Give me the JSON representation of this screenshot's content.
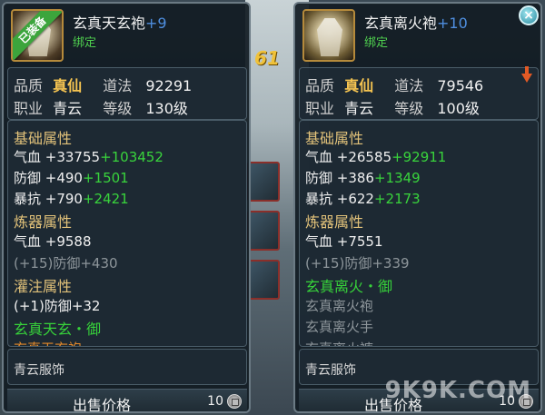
{
  "background": {
    "number": "61"
  },
  "left": {
    "ribbon": "已装备",
    "name": "玄真天玄袍",
    "plus": "+9",
    "bound": "绑定",
    "quality_label": "品质",
    "quality_value": "真仙",
    "daofa_label": "道法",
    "daofa_value": "92291",
    "class_label": "职业",
    "class_value": "青云",
    "level_label": "等级",
    "level_value": "130级",
    "lines": [
      {
        "text": "基础属性",
        "bonus": "",
        "style": "head"
      },
      {
        "text": "气血 +33755",
        "bonus": "+103452",
        "style": "normal"
      },
      {
        "text": "防御 +490",
        "bonus": "+1501",
        "style": "normal"
      },
      {
        "text": "暴抗 +790",
        "bonus": "+2421",
        "style": "normal"
      },
      {
        "text": "炼器属性",
        "bonus": "",
        "style": "head"
      },
      {
        "text": "气血 +9588",
        "bonus": "",
        "style": "normal"
      },
      {
        "text": "(+15)防御+430",
        "bonus": "",
        "style": "grey"
      },
      {
        "text": "灌注属性",
        "bonus": "",
        "style": "head"
      },
      {
        "text": "(+1)防御+32",
        "bonus": "",
        "style": "normal"
      },
      {
        "text": "玄真天玄・御",
        "bonus": "",
        "style": "green"
      },
      {
        "text": "玄真天玄袍",
        "bonus": "",
        "style": "orange"
      }
    ],
    "tag": "青云服饰",
    "price_label": "出售价格",
    "price_value": "10"
  },
  "right": {
    "name": "玄真离火袍",
    "plus": "+10",
    "bound": "绑定",
    "quality_label": "品质",
    "quality_value": "真仙",
    "daofa_label": "道法",
    "daofa_value": "79546",
    "class_label": "职业",
    "class_value": "青云",
    "level_label": "等级",
    "level_value": "100级",
    "lines": [
      {
        "text": "基础属性",
        "bonus": "",
        "style": "head"
      },
      {
        "text": "气血 +26585",
        "bonus": "+92911",
        "style": "normal"
      },
      {
        "text": "防御 +386",
        "bonus": "+1349",
        "style": "normal"
      },
      {
        "text": "暴抗 +622",
        "bonus": "+2173",
        "style": "normal"
      },
      {
        "text": "炼器属性",
        "bonus": "",
        "style": "head"
      },
      {
        "text": "气血 +7551",
        "bonus": "",
        "style": "normal"
      },
      {
        "text": "(+15)防御+339",
        "bonus": "",
        "style": "grey"
      },
      {
        "text": "玄真离火・御",
        "bonus": "",
        "style": "green"
      },
      {
        "text": "玄真离火袍",
        "bonus": "",
        "style": "grey"
      },
      {
        "text": "玄真离火手",
        "bonus": "",
        "style": "grey"
      },
      {
        "text": "玄真离火裤",
        "bonus": "",
        "style": "grey"
      }
    ],
    "tag": "青云服饰",
    "price_label": "出售价格",
    "price_value": "10",
    "close": "×"
  },
  "watermark": "9K9K.COM",
  "colors": {
    "bonus": "#39d43c",
    "gold": "#f5c451",
    "plus": "#4f8fe0",
    "section_head": "#e2c27a"
  }
}
